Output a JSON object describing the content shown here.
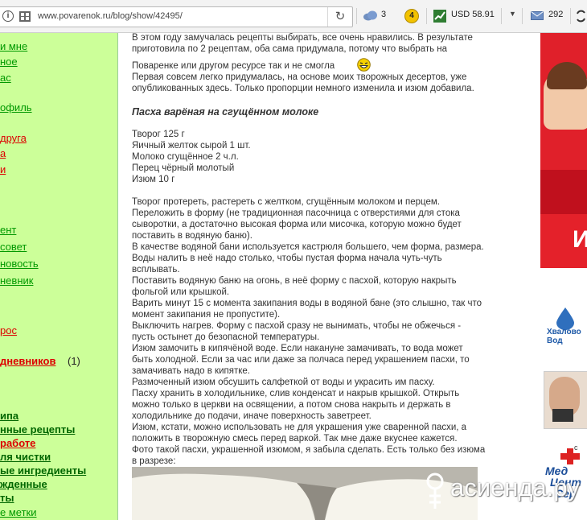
{
  "browser": {
    "url": "www.povarenok.ru/blog/show/42495/",
    "weather_count": "3",
    "badge_number": "4",
    "currency": "USD 58.91",
    "mail_count": "292"
  },
  "leftnav": {
    "links": [
      {
        "text": "и мне",
        "color": "green"
      },
      {
        "text": "ное",
        "color": "green"
      },
      {
        "text": "ас",
        "color": "green"
      },
      {
        "text": "офиль",
        "color": "green"
      },
      {
        "text": "друга",
        "color": "red"
      },
      {
        "text": "а",
        "color": "red"
      },
      {
        "text": "и",
        "color": "red"
      },
      {
        "text": "ент",
        "color": "green"
      },
      {
        "text": "совет",
        "color": "green"
      },
      {
        "text": "новость",
        "color": "green"
      },
      {
        "text": "невник",
        "color": "green"
      },
      {
        "text": "рос",
        "color": "red"
      },
      {
        "text": "дневников",
        "count": "(1)",
        "color": "red"
      },
      {
        "text": "ипа",
        "color": "green"
      },
      {
        "text": "нные рецепты",
        "color": "green"
      },
      {
        "text": "работе",
        "color": "red"
      },
      {
        "text": "ля чистки",
        "color": "green"
      },
      {
        "text": "ые ингредиенты",
        "color": "green"
      },
      {
        "text": "жденные",
        "color": "green"
      },
      {
        "text": "ты",
        "color": "green"
      },
      {
        "text": "е метки",
        "color": "green"
      }
    ]
  },
  "article": {
    "intro": [
      "В этом году замучалась рецепты выбирать, все очень нравились. В результате",
      "приготовила по 2 рецептам, оба сама придумала, потому что выбрать на",
      "Поваренке или другом ресурсе так и не смогла",
      "Первая совсем легко придумалась, на основе моих творожных десертов, уже",
      "опубликованных здесь. Только пропорции немного изменила и изюм добавила."
    ],
    "recipe_title": "Пасха варёная на сгущённом молоке",
    "ingredients": [
      "Творог 125 г",
      "Яичный желток сырой 1 шт.",
      "Молоко сгущённое 2 ч.л.",
      "Перец чёрный молотый",
      "Изюм 10 г"
    ],
    "steps": [
      "Творог протереть, растереть с желтком, сгущённым молоком и перцем.",
      "Переложить в форму (не традиционная пасочница с отверстиями для стока",
      "сыворотки, а достаточно высокая форма или мисочка, которую можно будет",
      "поставить в водяную баню).",
      "В качестве водяной бани используется кастрюля большего, чем форма, размера.",
      "Воды налить в неё надо столько, чтобы пустая форма начала чуть-чуть",
      "всплывать.",
      "Поставить водяную баню на огонь, в неё форму с пасхой, которую накрыть",
      "фольгой или крышкой.",
      "Варить минут 15 с момента закипания воды в водяной бане (это слышно, так что",
      "момент закипания не пропустите).",
      "Выключить нагрев. Форму с пасхой сразу не вынимать, чтобы не обжечься -",
      "пусть остынет до безопасной температуры.",
      "Изюм замочить в кипячёной воде. Если накануне замачивать, то вода может",
      "быть холодной. Если за час или даже за полчаса перед украшением пасхи, то",
      "замачивать надо в кипятке.",
      "Размоченный изюм обсушить салфеткой от воды и украсить им пасху.",
      "Пасху хранить в холодильнике, слив конденсат и накрыв крышкой. Открыть",
      "можно только в церкви на освящении, а потом снова накрыть и держать в",
      "холодильнике до подачи, иначе поверхность заветреет.",
      "Изюм, кстати, можно использовать не для украшения уже сваренной пасхи, а",
      "положить в творожную смесь перед варкой. Так мне даже вкуснее кажется.",
      "Фото такой пасхи, украшенной изюмом, я забыла сделать. Есть только без изюма",
      "в разрезе:"
    ]
  },
  "ads": {
    "banner_letter": "И",
    "water_brand": "Хвалово Вод",
    "clinic_lines": [
      "Мед",
      "Цент",
      "Сер"
    ],
    "clinic_small": "с"
  },
  "watermark": {
    "text": "асиенда.ру"
  },
  "colors": {
    "nav_bg": "#ccff99",
    "link_green": "#009900",
    "link_red": "#dd0000",
    "banner_red": "#e0202a"
  }
}
